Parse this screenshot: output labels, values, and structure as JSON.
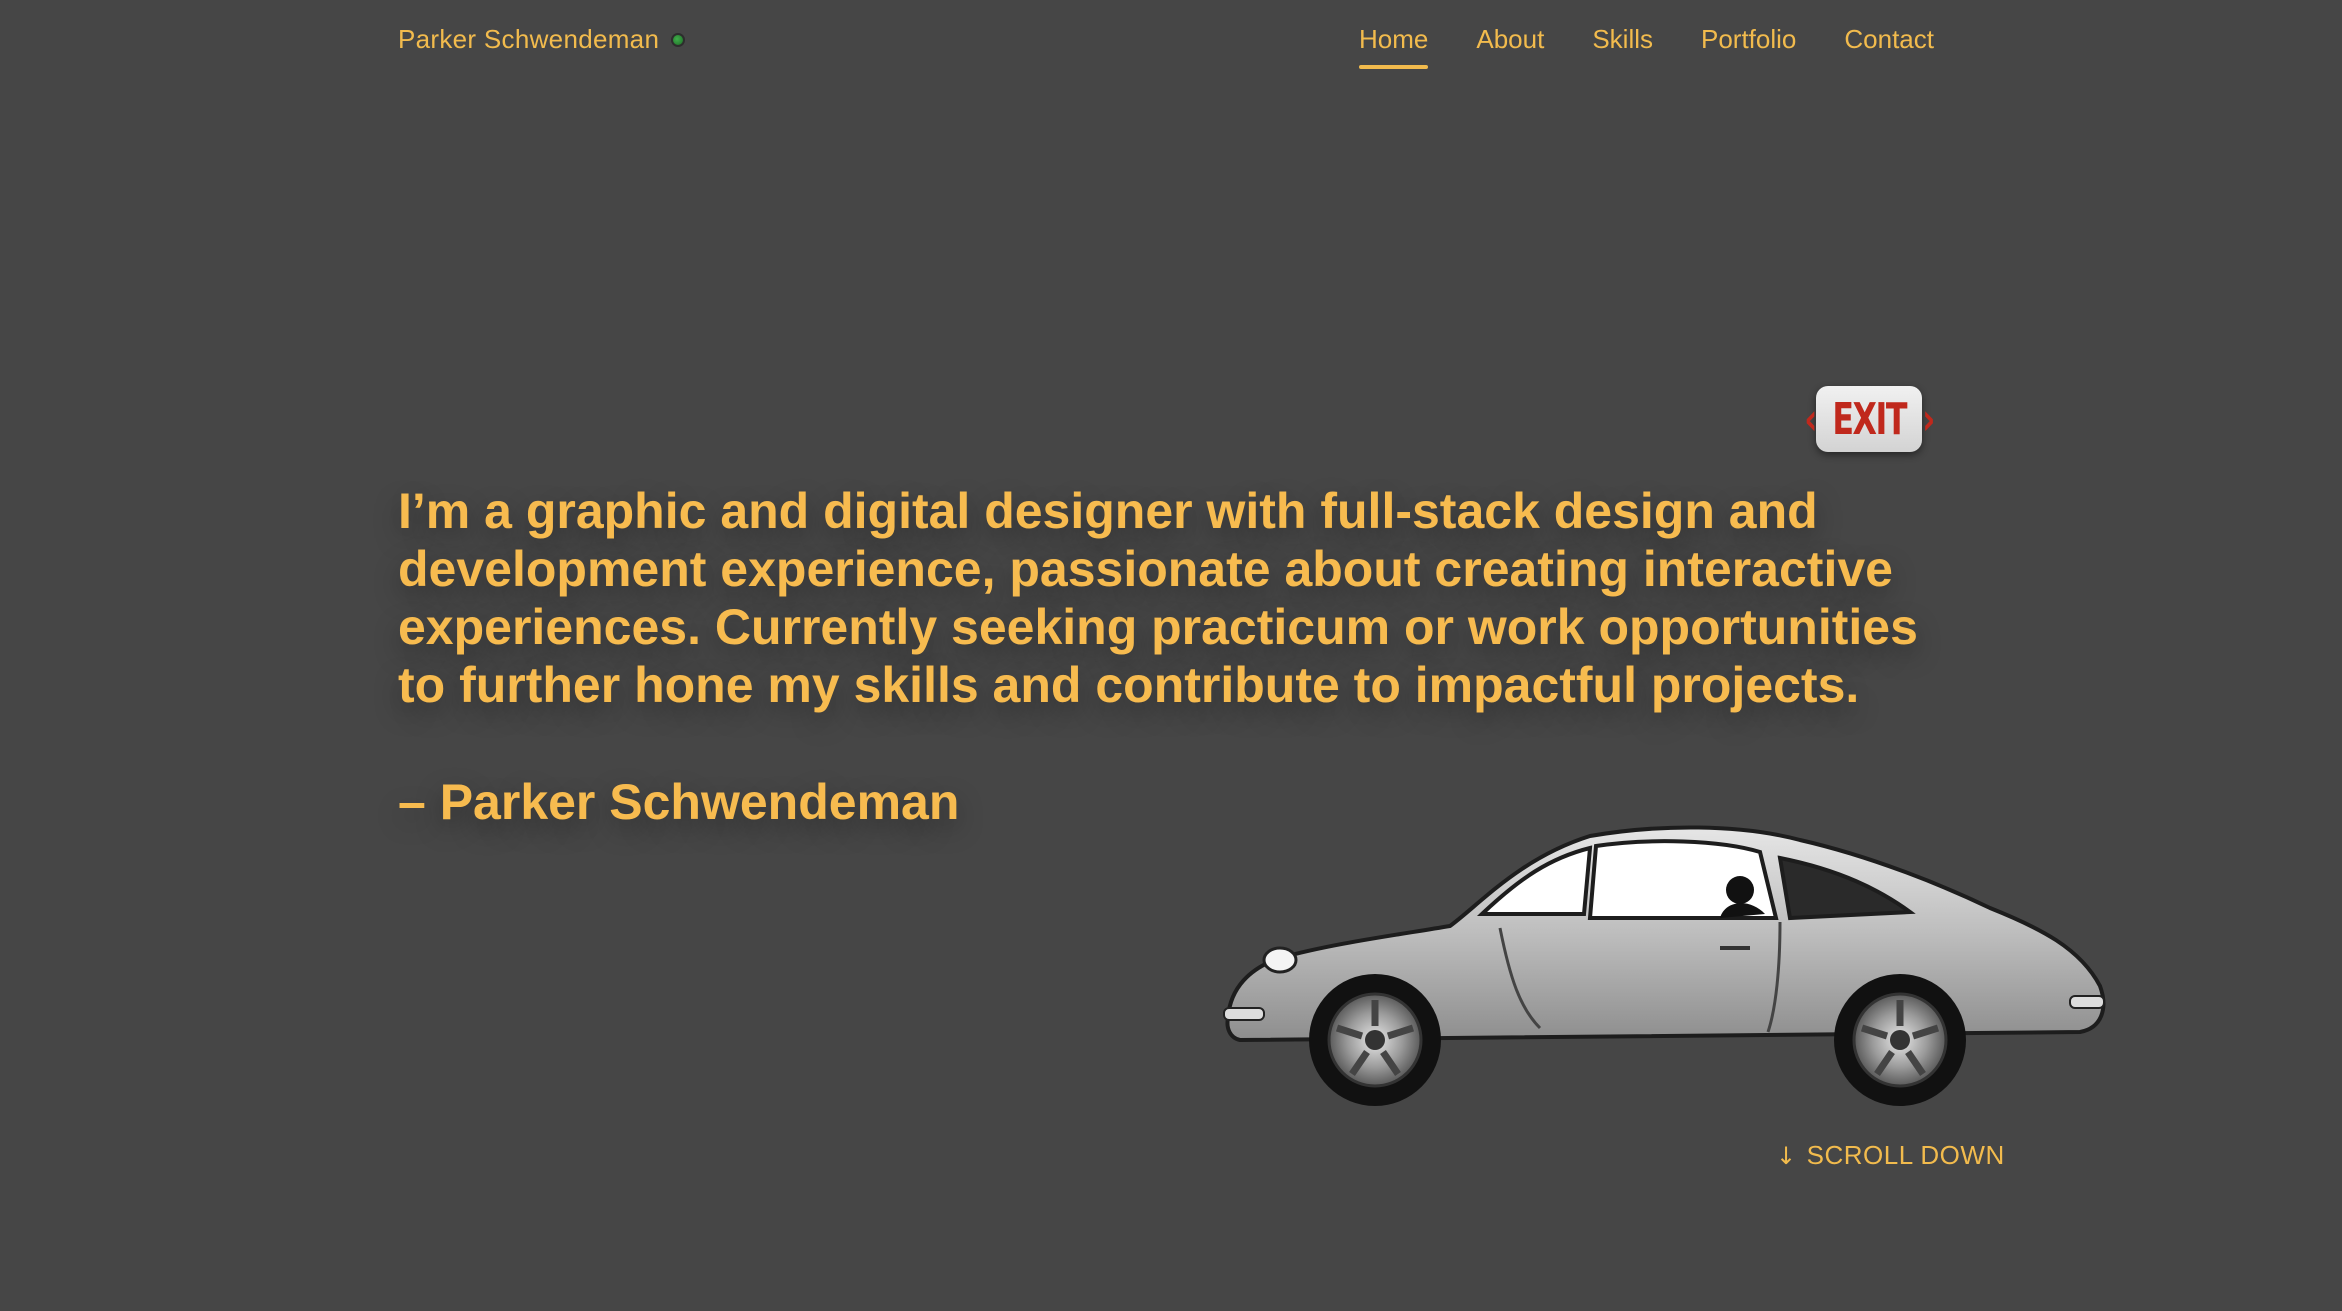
{
  "header": {
    "brand_name": "Parker Schwendeman",
    "status_color": "#2f8f3a"
  },
  "nav": {
    "items": [
      {
        "label": "Home",
        "active": true
      },
      {
        "label": "About",
        "active": false
      },
      {
        "label": "Skills",
        "active": false
      },
      {
        "label": "Portfolio",
        "active": false
      },
      {
        "label": "Contact",
        "active": false
      }
    ]
  },
  "exit_sign": {
    "text": "EXIT",
    "left_arrow": "‹",
    "right_arrow": "›"
  },
  "hero": {
    "quote": "I’m a graphic and digital designer with full-stack design and development experience, passionate about creating interactive experiences. Currently seeking practicum or work opportunities to further hone my skills and contribute to impactful projects.",
    "attribution": "– Parker Schwendeman"
  },
  "car_illustration": {
    "icon": "vintage-sports-car-illustration"
  },
  "scroll": {
    "arrow": "↓",
    "label": "SCROLL DOWN"
  },
  "colors": {
    "background": "#464646",
    "accent": "#f2bb4d",
    "exit_red": "#c0281c"
  }
}
